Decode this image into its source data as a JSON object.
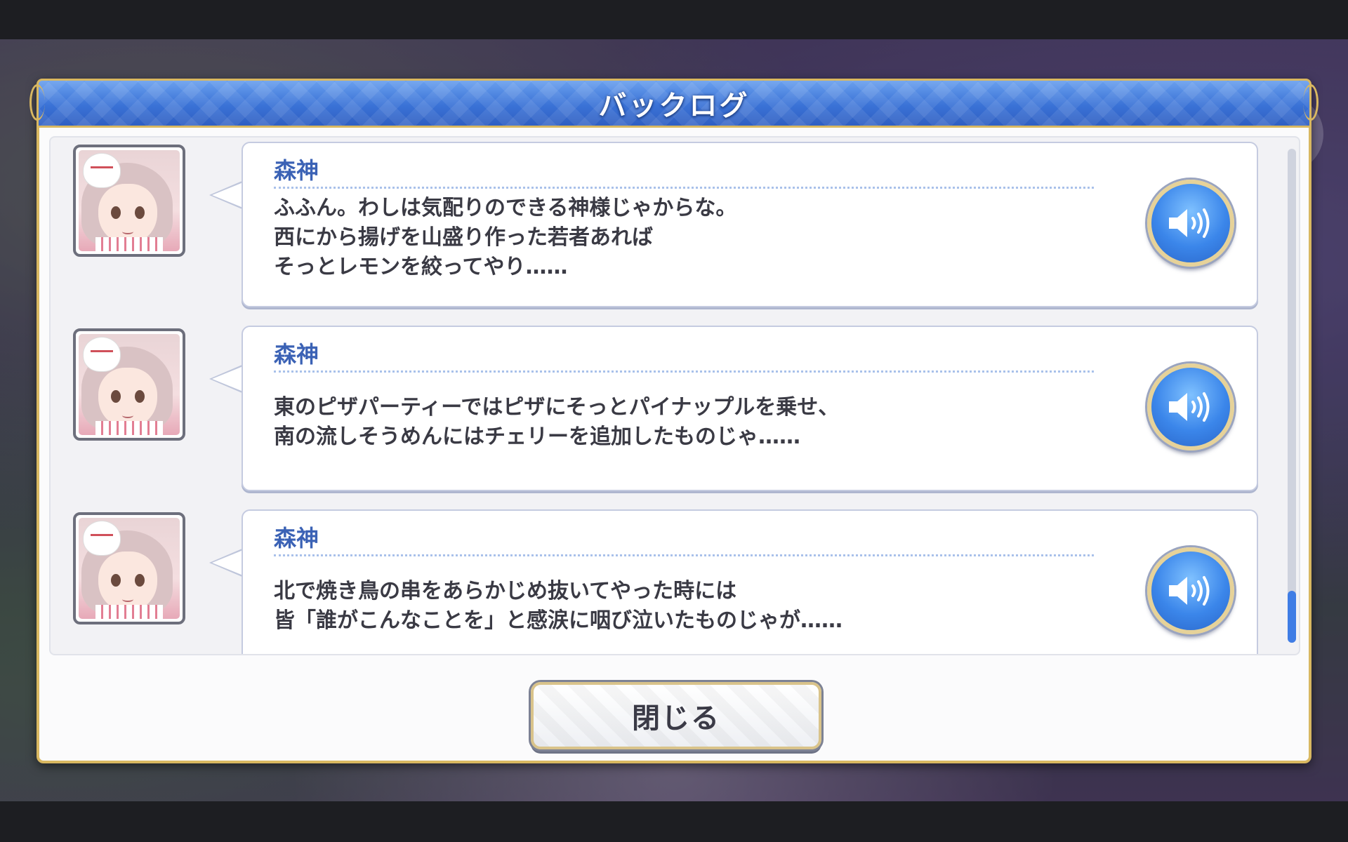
{
  "dialog": {
    "title": "バックログ",
    "close_label": "閉じる"
  },
  "entries": [
    {
      "speaker": "森神",
      "text": "ふふん。わしは気配りのできる神様じゃからな。\n西にから揚げを山盛り作った若者あれば\nそっとレモンを絞ってやり……",
      "voice_icon": "speaker-icon"
    },
    {
      "speaker": "森神",
      "text": "東のピザパーティーではピザにそっとパイナップルを乗せ、\n南の流しそうめんにはチェリーを追加したものじゃ……",
      "voice_icon": "speaker-icon"
    },
    {
      "speaker": "森神",
      "text": "北で焼き鳥の串をあらかじめ抜いてやった時には\n皆「誰がこんなことを」と感涙に咽び泣いたものじゃが……",
      "voice_icon": "speaker-icon"
    }
  ],
  "colors": {
    "header_blue": "#3a72d6",
    "gold_frame": "#d9b861",
    "speaker_name": "#3b62b5",
    "voice_button": "#3b86ea"
  }
}
